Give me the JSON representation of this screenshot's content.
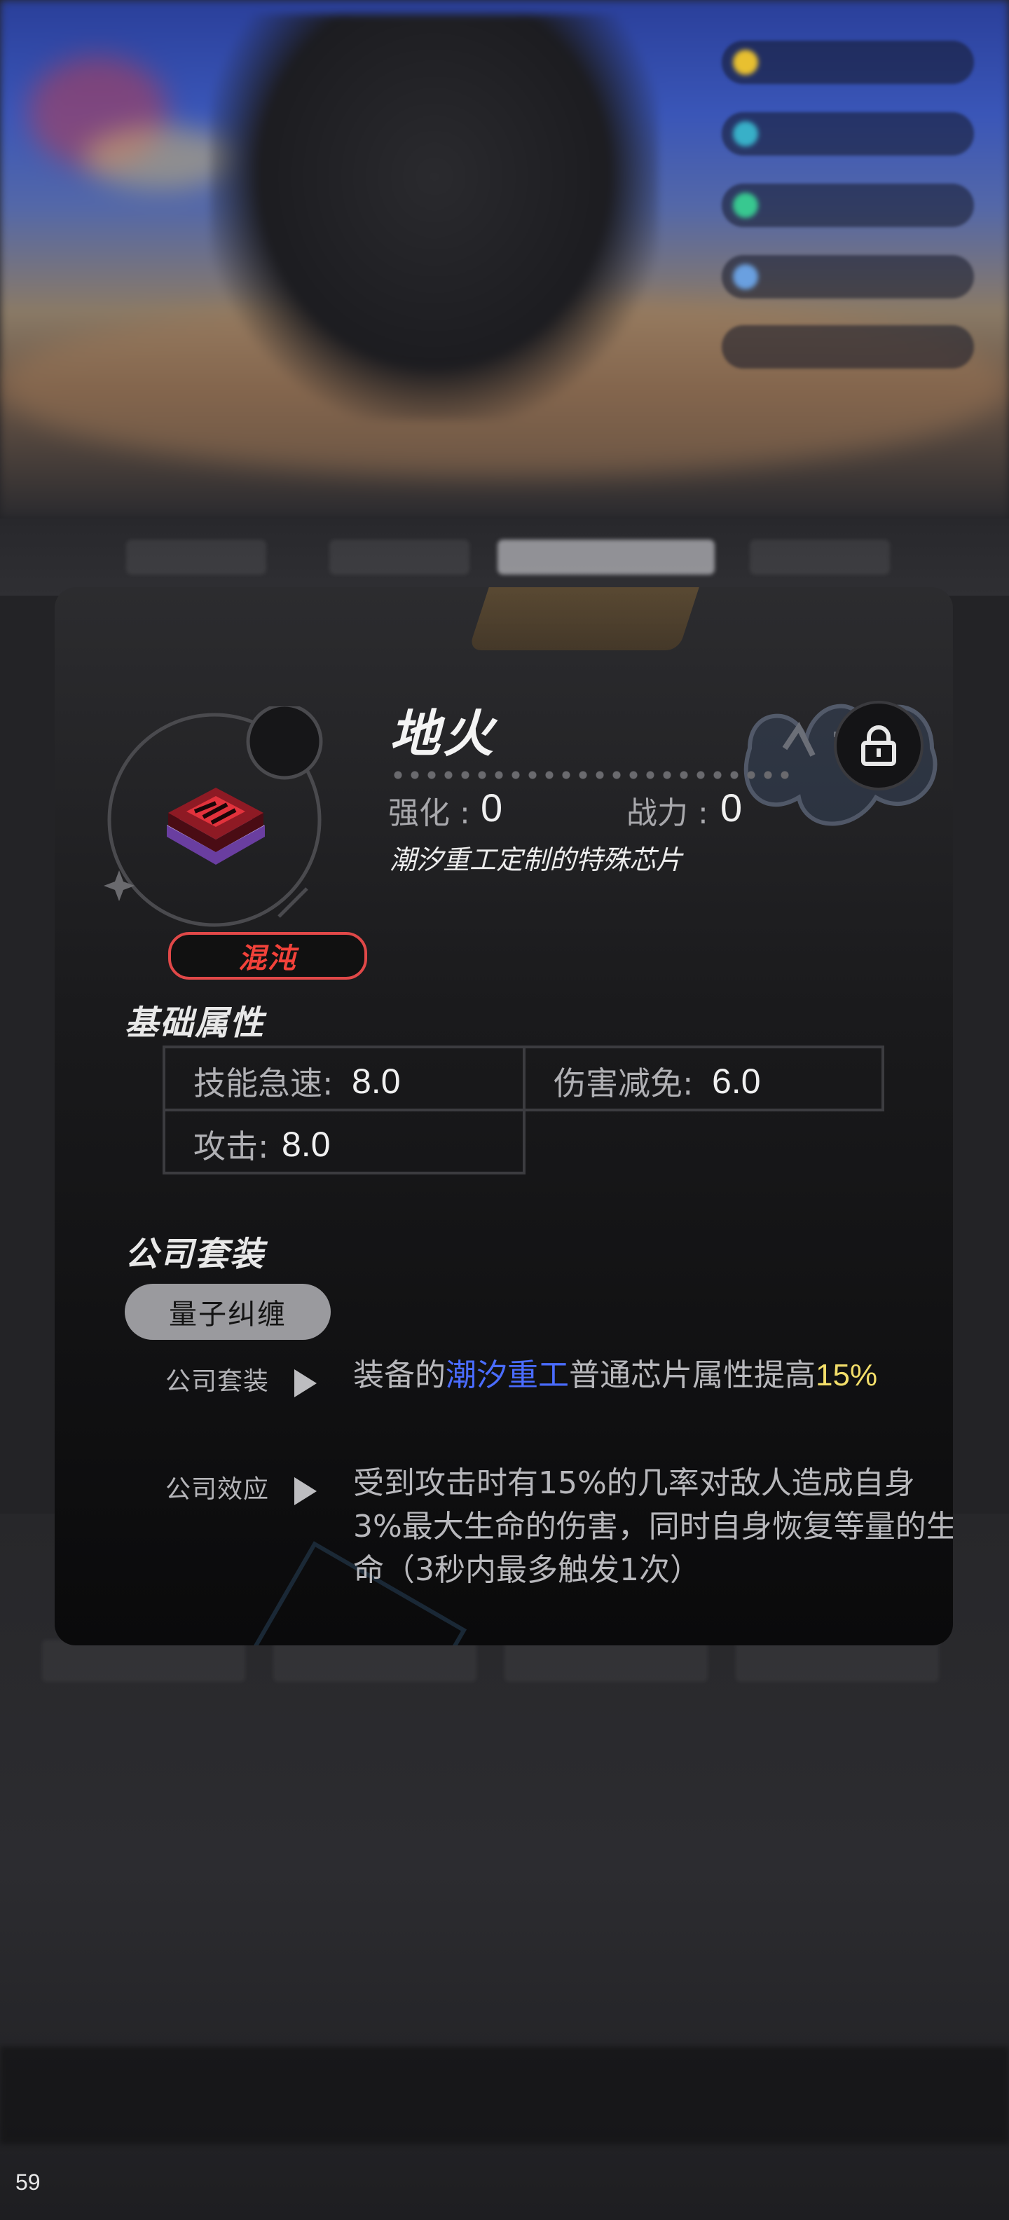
{
  "fps_counter": "59",
  "chip": {
    "name": "地火",
    "rarity": "混沌",
    "description": "潮汐重工定制的特殊芯片",
    "enhance_label": "强化",
    "enhance_value": "0",
    "power_label": "战力",
    "power_value": "0",
    "locked": true
  },
  "base_attributes": {
    "heading": "基础属性",
    "items": [
      {
        "label": "技能急速",
        "value": "8.0"
      },
      {
        "label": "伤害减免",
        "value": "6.0"
      },
      {
        "label": "攻击",
        "value": "8.0"
      }
    ]
  },
  "company_suit": {
    "heading": "公司套装",
    "suit_name": "量子纠缠",
    "effects": [
      {
        "label": "公司套装",
        "text_before": "装备的",
        "company": "潮汐重工",
        "text_mid": "普通芯片属性提高",
        "bonus": "15%"
      },
      {
        "label": "公司效应",
        "text": "受到攻击时有15%的几率对敌人造成自身3%最大生命的伤害，同时自身恢复等量的生命（3秒内最多触发1次）"
      }
    ]
  },
  "colors": {
    "rarity_red": "#e04848",
    "company_blue": "#4a6cff",
    "bonus_yellow": "#f3de6a"
  }
}
